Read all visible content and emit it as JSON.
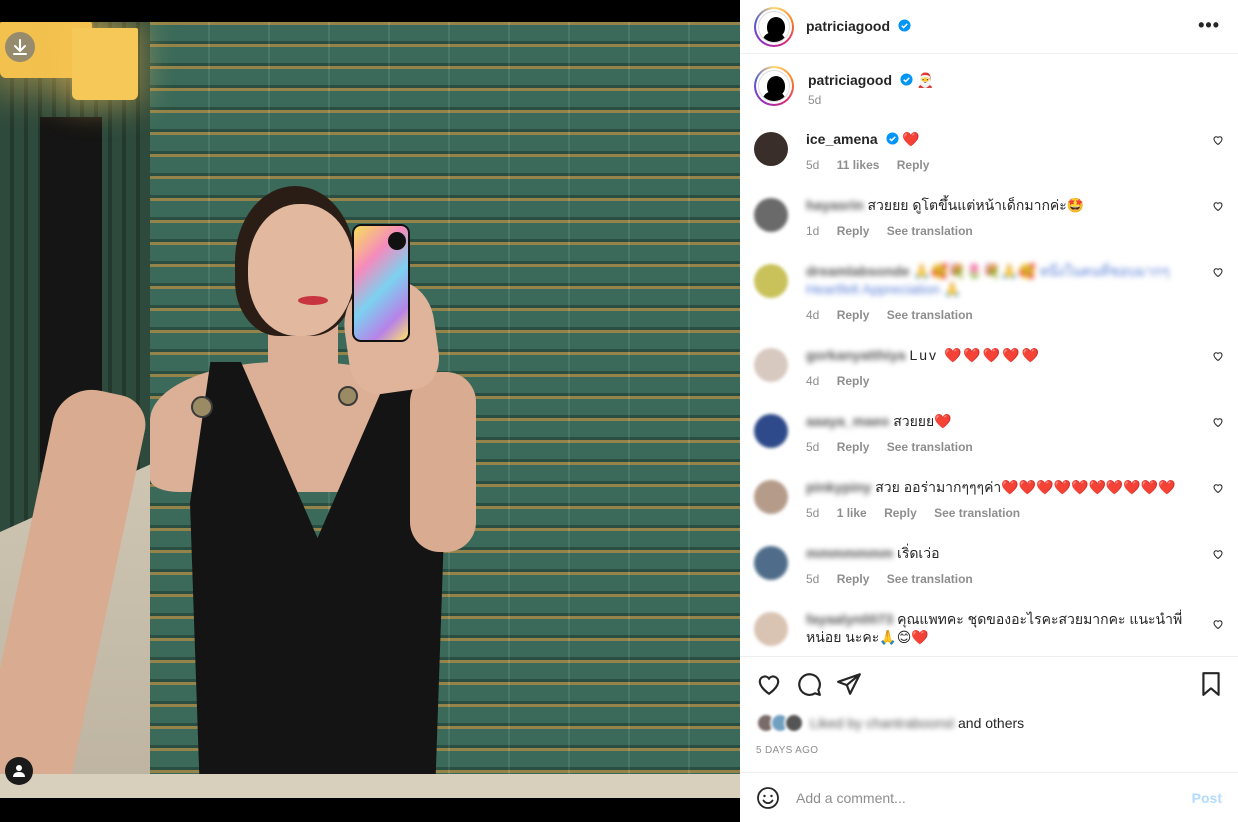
{
  "post": {
    "username": "patriciagood",
    "verified": true,
    "more_label": "•••"
  },
  "caption": {
    "username": "patriciagood",
    "emoji": "🎅",
    "time": "5d"
  },
  "comments": [
    {
      "user": "ice_amena",
      "blurred": false,
      "text": "❤️",
      "time": "5d",
      "likes": "11 likes",
      "reply": "Reply",
      "translate": "",
      "avatar_color": "#3a2e2a"
    },
    {
      "user": "hayasrin",
      "blurred": true,
      "text": "สวยยย ดูโตขึ้นแต่หน้าเด็กมากค่ะ🤩",
      "time": "1d",
      "likes": "",
      "reply": "Reply",
      "translate": "See translation",
      "avatar_color": "#6a6a6a"
    },
    {
      "user": "dreamlabsonde",
      "blurred": true,
      "text": "🙏🥰💐🌷💐🙏🥰 หนึ่งในคนที่ชอบมากๆ Heartfelt Appreciation 🙏",
      "time": "4d",
      "likes": "",
      "reply": "Reply",
      "translate": "See translation",
      "avatar_color": "#c9c25a"
    },
    {
      "user": "gorkanyatthiya",
      "blurred": true,
      "text": "Luv ❤️❤️❤️❤️❤️",
      "time": "4d",
      "likes": "",
      "reply": "Reply",
      "translate": "",
      "avatar_color": "#d8c9c0"
    },
    {
      "user": "aaaya_maeo",
      "blurred": true,
      "text": "สวยยย❤️",
      "time": "5d",
      "likes": "",
      "reply": "Reply",
      "translate": "See translation",
      "avatar_color": "#2f4a8a"
    },
    {
      "user": "pinkypiny",
      "blurred": true,
      "text": "สวย ออร่ามากๆๆๆค่า❤️❤️❤️❤️❤️❤️❤️❤️❤️❤️",
      "time": "5d",
      "likes": "1 like",
      "reply": "Reply",
      "translate": "See translation",
      "avatar_color": "#b59b8a"
    },
    {
      "user": "mmmmmmm",
      "blurred": true,
      "text": "เริ่ดเว่อ",
      "time": "5d",
      "likes": "",
      "reply": "Reply",
      "translate": "See translation",
      "avatar_color": "#4f6d8a"
    },
    {
      "user": "fayaalyn0073",
      "blurred": true,
      "text": "คุณแพทคะ ชุดของอะไรคะสวยมากคะ แนะนำพี่หน่อย นะคะ🙏😊❤️",
      "time": "",
      "likes": "",
      "reply": "",
      "translate": "",
      "avatar_color": "#d9c3b2"
    }
  ],
  "actions": {
    "liked_by_blurred": "Liked by chantraboonsl",
    "and_others": "and others",
    "date": "5 DAYS AGO"
  },
  "add_comment": {
    "placeholder": "Add a comment...",
    "post_label": "Post"
  },
  "colors": {
    "accent_blue": "#0095f6",
    "heart_red": "#ed2f45",
    "post_disabled": "#b3dbff"
  }
}
